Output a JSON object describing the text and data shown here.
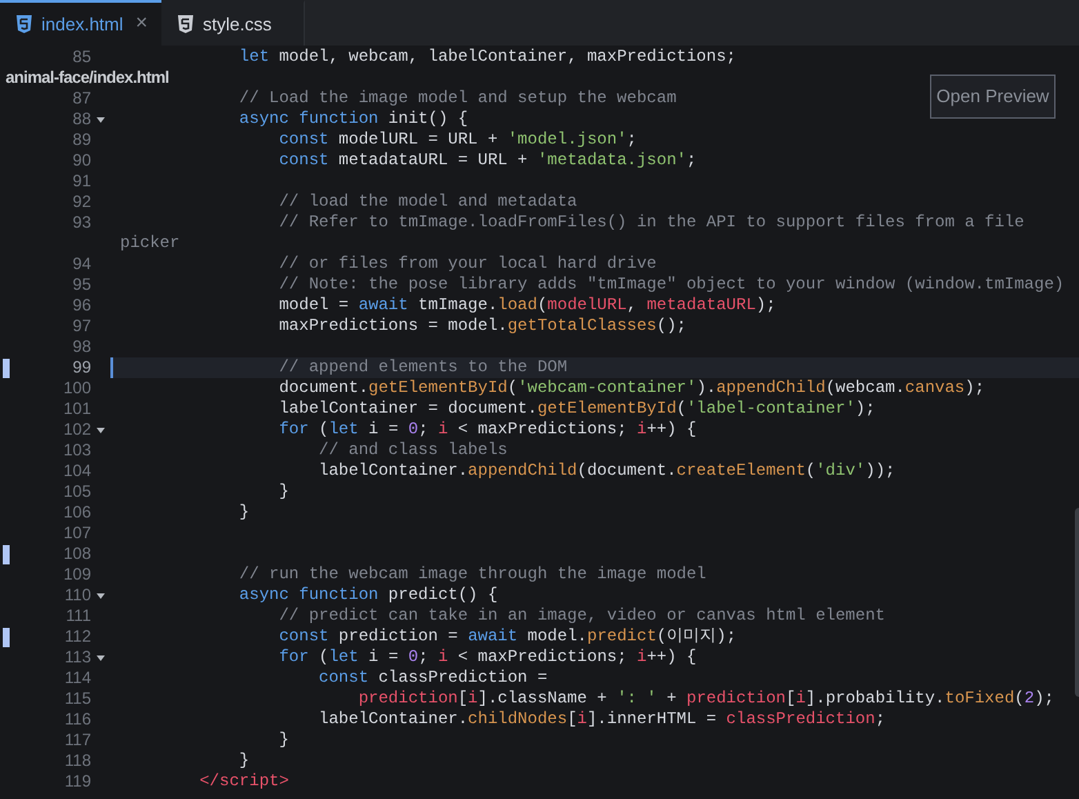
{
  "tabs": [
    {
      "label": "index.html",
      "selected": true,
      "close": "×"
    },
    {
      "label": "style.css",
      "selected": false
    }
  ],
  "preview_button": "Open Preview",
  "lines": [
    {
      "number": "85",
      "current": false,
      "modified": false,
      "foldable": false,
      "code": [
        {
          "kind": "keyword",
          "text": "            let"
        },
        {
          "kind": "plain",
          "text": " model, webcam, labelContainer, maxPredictions;"
        }
      ]
    },
    {
      "file_path": "animal-face/index.html"
    },
    {
      "number": "87",
      "current": false,
      "modified": false,
      "foldable": false,
      "code": [
        {
          "kind": "comment",
          "text": "            // Load the image model and setup the webcam"
        }
      ]
    },
    {
      "number": "88",
      "current": false,
      "modified": false,
      "foldable": true,
      "code": [
        {
          "kind": "keyword",
          "text": "            async function"
        },
        {
          "kind": "plain",
          "text": " init() {"
        }
      ]
    },
    {
      "number": "89",
      "current": false,
      "modified": false,
      "foldable": false,
      "code": [
        {
          "kind": "keyword",
          "text": "                const"
        },
        {
          "kind": "plain",
          "text": " modelURL = URL + "
        },
        {
          "kind": "string",
          "text": "'model.json'"
        },
        {
          "kind": "plain",
          "text": ";"
        }
      ]
    },
    {
      "number": "90",
      "current": false,
      "modified": false,
      "foldable": false,
      "code": [
        {
          "kind": "keyword",
          "text": "                const"
        },
        {
          "kind": "plain",
          "text": " metadataURL = URL + "
        },
        {
          "kind": "string",
          "text": "'metadata.json'"
        },
        {
          "kind": "plain",
          "text": ";"
        }
      ]
    },
    {
      "number": "91",
      "current": false,
      "modified": false,
      "foldable": false
    },
    {
      "number": "92",
      "current": false,
      "modified": false,
      "foldable": false,
      "code": [
        {
          "kind": "comment",
          "text": "                // load the model and metadata"
        }
      ]
    },
    {
      "number": "93",
      "current": false,
      "modified": false,
      "foldable": false,
      "code": [
        {
          "kind": "comment",
          "text": "                // Refer to tmImage.loadFromFiles() in the API to support files from a file"
        }
      ],
      "wrap": "picker"
    },
    {
      "number": "94",
      "current": false,
      "modified": false,
      "foldable": false,
      "code": [
        {
          "kind": "comment",
          "text": "                // or files from your local hard drive"
        }
      ]
    },
    {
      "number": "95",
      "current": false,
      "modified": false,
      "foldable": false,
      "code": [
        {
          "kind": "comment",
          "text": "                // Note: the pose library adds \"tmImage\" object to your window (window.tmImage)"
        }
      ]
    },
    {
      "number": "96",
      "current": false,
      "modified": false,
      "foldable": false,
      "code": [
        {
          "kind": "plain",
          "text": "                model = "
        },
        {
          "kind": "keyword",
          "text": "await"
        },
        {
          "kind": "plain",
          "text": " tmImage."
        },
        {
          "kind": "function",
          "text": "load"
        },
        {
          "kind": "plain",
          "text": "("
        },
        {
          "kind": "variable",
          "text": "modelURL"
        },
        {
          "kind": "plain",
          "text": ", "
        },
        {
          "kind": "variable",
          "text": "metadataURL"
        },
        {
          "kind": "plain",
          "text": ");"
        }
      ]
    },
    {
      "number": "97",
      "current": false,
      "modified": false,
      "foldable": false,
      "code": [
        {
          "kind": "plain",
          "text": "                maxPredictions = model."
        },
        {
          "kind": "function",
          "text": "getTotalClasses"
        },
        {
          "kind": "plain",
          "text": "();"
        }
      ]
    },
    {
      "number": "98",
      "current": false,
      "modified": false,
      "foldable": false
    },
    {
      "number": "99",
      "current": true,
      "modified": true,
      "foldable": false,
      "code": [
        {
          "kind": "comment",
          "text": "                // append elements to the DOM"
        }
      ]
    },
    {
      "number": "100",
      "current": false,
      "modified": false,
      "foldable": false,
      "code": [
        {
          "kind": "plain",
          "text": "                document."
        },
        {
          "kind": "function",
          "text": "getElementById"
        },
        {
          "kind": "plain",
          "text": "("
        },
        {
          "kind": "string",
          "text": "'webcam-container'"
        },
        {
          "kind": "plain",
          "text": ")."
        },
        {
          "kind": "function",
          "text": "appendChild"
        },
        {
          "kind": "plain",
          "text": "(webcam."
        },
        {
          "kind": "function",
          "text": "canvas"
        },
        {
          "kind": "plain",
          "text": ");"
        }
      ]
    },
    {
      "number": "101",
      "current": false,
      "modified": false,
      "foldable": false,
      "code": [
        {
          "kind": "plain",
          "text": "                labelContainer = document."
        },
        {
          "kind": "function",
          "text": "getElementById"
        },
        {
          "kind": "plain",
          "text": "("
        },
        {
          "kind": "string",
          "text": "'label-container'"
        },
        {
          "kind": "plain",
          "text": ");"
        }
      ]
    },
    {
      "number": "102",
      "current": false,
      "modified": false,
      "foldable": true,
      "code": [
        {
          "kind": "keyword",
          "text": "                for"
        },
        {
          "kind": "plain",
          "text": " ("
        },
        {
          "kind": "keyword",
          "text": "let"
        },
        {
          "kind": "plain",
          "text": " i = "
        },
        {
          "kind": "number",
          "text": "0"
        },
        {
          "kind": "plain",
          "text": "; "
        },
        {
          "kind": "variable",
          "text": "i"
        },
        {
          "kind": "plain",
          "text": " < maxPredictions; "
        },
        {
          "kind": "variable",
          "text": "i"
        },
        {
          "kind": "plain",
          "text": "++) {"
        }
      ]
    },
    {
      "number": "103",
      "current": false,
      "modified": false,
      "foldable": false,
      "code": [
        {
          "kind": "comment",
          "text": "                    // and class labels"
        }
      ]
    },
    {
      "number": "104",
      "current": false,
      "modified": false,
      "foldable": false,
      "code": [
        {
          "kind": "plain",
          "text": "                    labelContainer."
        },
        {
          "kind": "function",
          "text": "appendChild"
        },
        {
          "kind": "plain",
          "text": "(document."
        },
        {
          "kind": "function",
          "text": "createElement"
        },
        {
          "kind": "plain",
          "text": "("
        },
        {
          "kind": "string",
          "text": "'div'"
        },
        {
          "kind": "plain",
          "text": "));"
        }
      ]
    },
    {
      "number": "105",
      "current": false,
      "modified": false,
      "foldable": false,
      "code": [
        {
          "kind": "plain",
          "text": "                }"
        }
      ]
    },
    {
      "number": "106",
      "current": false,
      "modified": false,
      "foldable": false,
      "code": [
        {
          "kind": "plain",
          "text": "            }"
        }
      ]
    },
    {
      "number": "107",
      "current": false,
      "modified": false,
      "foldable": false
    },
    {
      "number": "108",
      "current": false,
      "modified": true,
      "foldable": false
    },
    {
      "number": "109",
      "current": false,
      "modified": false,
      "foldable": false,
      "code": [
        {
          "kind": "comment",
          "text": "            // run the webcam image through the image model"
        }
      ]
    },
    {
      "number": "110",
      "current": false,
      "modified": false,
      "foldable": true,
      "code": [
        {
          "kind": "keyword",
          "text": "            async function"
        },
        {
          "kind": "plain",
          "text": " predict() {"
        }
      ]
    },
    {
      "number": "111",
      "current": false,
      "modified": false,
      "foldable": false,
      "code": [
        {
          "kind": "comment",
          "text": "                // predict can take in an image, video or canvas html element"
        }
      ]
    },
    {
      "number": "112",
      "current": false,
      "modified": true,
      "foldable": false,
      "code": [
        {
          "kind": "keyword",
          "text": "                const"
        },
        {
          "kind": "plain",
          "text": " prediction = "
        },
        {
          "kind": "keyword",
          "text": "await"
        },
        {
          "kind": "plain",
          "text": " model."
        },
        {
          "kind": "function",
          "text": "predict"
        },
        {
          "kind": "plain",
          "text": "(이미지);"
        }
      ]
    },
    {
      "number": "113",
      "current": false,
      "modified": false,
      "foldable": true,
      "code": [
        {
          "kind": "keyword",
          "text": "                for"
        },
        {
          "kind": "plain",
          "text": " ("
        },
        {
          "kind": "keyword",
          "text": "let"
        },
        {
          "kind": "plain",
          "text": " i = "
        },
        {
          "kind": "number",
          "text": "0"
        },
        {
          "kind": "plain",
          "text": "; "
        },
        {
          "kind": "variable",
          "text": "i"
        },
        {
          "kind": "plain",
          "text": " < maxPredictions; "
        },
        {
          "kind": "variable",
          "text": "i"
        },
        {
          "kind": "plain",
          "text": "++) {"
        }
      ]
    },
    {
      "number": "114",
      "current": false,
      "modified": false,
      "foldable": false,
      "code": [
        {
          "kind": "keyword",
          "text": "                    const"
        },
        {
          "kind": "plain",
          "text": " classPrediction ="
        }
      ]
    },
    {
      "number": "115",
      "current": false,
      "modified": false,
      "foldable": false,
      "code": [
        {
          "kind": "variable",
          "text": "                        prediction"
        },
        {
          "kind": "plain",
          "text": "["
        },
        {
          "kind": "variable",
          "text": "i"
        },
        {
          "kind": "plain",
          "text": "].className + "
        },
        {
          "kind": "string",
          "text": "': '"
        },
        {
          "kind": "plain",
          "text": " + "
        },
        {
          "kind": "variable",
          "text": "prediction"
        },
        {
          "kind": "plain",
          "text": "["
        },
        {
          "kind": "variable",
          "text": "i"
        },
        {
          "kind": "plain",
          "text": "].probability."
        },
        {
          "kind": "function",
          "text": "toFixed"
        },
        {
          "kind": "plain",
          "text": "("
        },
        {
          "kind": "number",
          "text": "2"
        },
        {
          "kind": "plain",
          "text": ");"
        }
      ]
    },
    {
      "number": "116",
      "current": false,
      "modified": false,
      "foldable": false,
      "code": [
        {
          "kind": "plain",
          "text": "                    labelContainer."
        },
        {
          "kind": "function",
          "text": "childNodes"
        },
        {
          "kind": "plain",
          "text": "["
        },
        {
          "kind": "variable",
          "text": "i"
        },
        {
          "kind": "plain",
          "text": "].innerHTML = "
        },
        {
          "kind": "variable",
          "text": "classPrediction"
        },
        {
          "kind": "plain",
          "text": ";"
        }
      ]
    },
    {
      "number": "117",
      "current": false,
      "modified": false,
      "foldable": false,
      "code": [
        {
          "kind": "plain",
          "text": "                }"
        }
      ]
    },
    {
      "number": "118",
      "current": false,
      "modified": false,
      "foldable": false,
      "code": [
        {
          "kind": "plain",
          "text": "            }"
        }
      ]
    },
    {
      "number": "119",
      "current": false,
      "modified": false,
      "foldable": false,
      "code": [
        {
          "kind": "tag",
          "text": "        </script>"
        }
      ]
    }
  ]
}
